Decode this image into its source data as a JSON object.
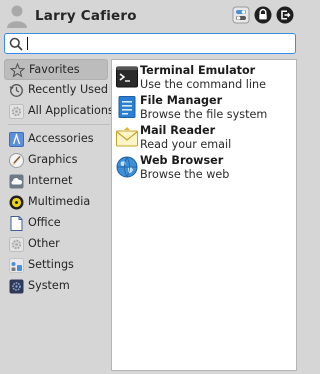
{
  "user": {
    "name": "Larry Cafiero"
  },
  "header_buttons": [
    {
      "name": "settings-toggle-icon"
    },
    {
      "name": "lock-icon"
    },
    {
      "name": "logout-icon"
    }
  ],
  "search": {
    "value": "",
    "placeholder": ""
  },
  "sidebar": {
    "items": [
      {
        "label": "Favorites",
        "icon": "star-icon",
        "active": true
      },
      {
        "label": "Recently Used",
        "icon": "clock-icon"
      },
      {
        "label": "All Applications",
        "icon": "gear-icon"
      },
      {
        "label": "Accessories",
        "icon": "accessories-icon"
      },
      {
        "label": "Graphics",
        "icon": "brush-icon"
      },
      {
        "label": "Internet",
        "icon": "cloud-icon"
      },
      {
        "label": "Multimedia",
        "icon": "media-icon"
      },
      {
        "label": "Office",
        "icon": "document-icon"
      },
      {
        "label": "Other",
        "icon": "gear-icon"
      },
      {
        "label": "Settings",
        "icon": "settings-icon"
      },
      {
        "label": "System",
        "icon": "system-icon"
      }
    ]
  },
  "apps": [
    {
      "title": "Terminal Emulator",
      "desc": "Use the command line",
      "icon": "terminal-icon"
    },
    {
      "title": "File Manager",
      "desc": "Browse the file system",
      "icon": "file-manager-icon"
    },
    {
      "title": "Mail Reader",
      "desc": "Read your email",
      "icon": "mail-icon"
    },
    {
      "title": "Web Browser",
      "desc": "Browse the web",
      "icon": "globe-icon"
    }
  ],
  "colors": {
    "accent": "#3a8ee6",
    "background": "#d6d6d6",
    "active_item": "#bcbcbc"
  }
}
